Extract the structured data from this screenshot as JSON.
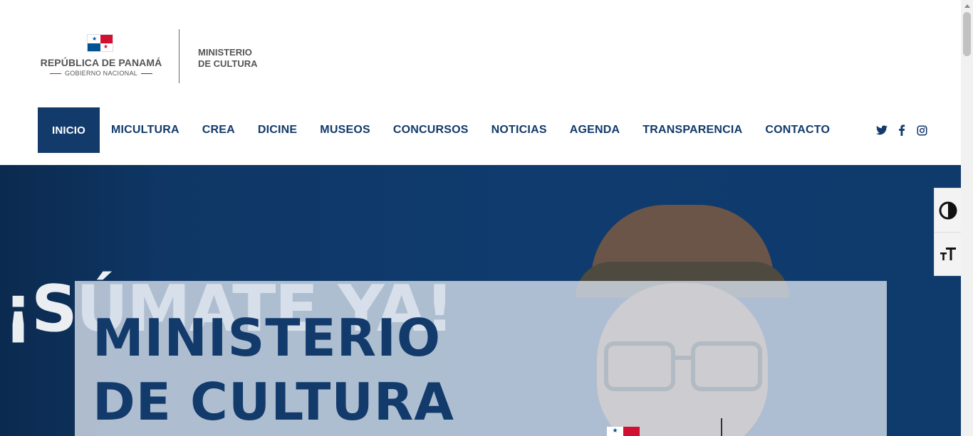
{
  "header": {
    "gov_title": "REPÚBLICA DE PANAMÁ",
    "gov_subtitle": "GOBIERNO NACIONAL",
    "ministry_line1": "MINISTERIO",
    "ministry_line2": "DE CULTURA"
  },
  "nav": {
    "items": [
      {
        "label": "INICIO",
        "active": true
      },
      {
        "label": "MICULTURA"
      },
      {
        "label": "CREA"
      },
      {
        "label": "DICINE"
      },
      {
        "label": "MUSEOS"
      },
      {
        "label": "CONCURSOS"
      },
      {
        "label": "NOTICIAS"
      },
      {
        "label": "AGENDA"
      },
      {
        "label": "TRANSPARENCIA"
      },
      {
        "label": "CONTACTO"
      }
    ],
    "social_icons": [
      "twitter-icon",
      "facebook-icon",
      "instagram-icon"
    ]
  },
  "hero": {
    "background_text": "¡SÚMATE YA!",
    "title_line1": "MINISTERIO",
    "title_line2": "DE CULTURA"
  },
  "accessibility": {
    "icons": [
      "contrast-icon",
      "text-size-icon"
    ]
  },
  "colors": {
    "primary": "#123a6b",
    "hero_bg": "#0f3b6e",
    "flag_red": "#d21034",
    "flag_blue": "#005293"
  }
}
